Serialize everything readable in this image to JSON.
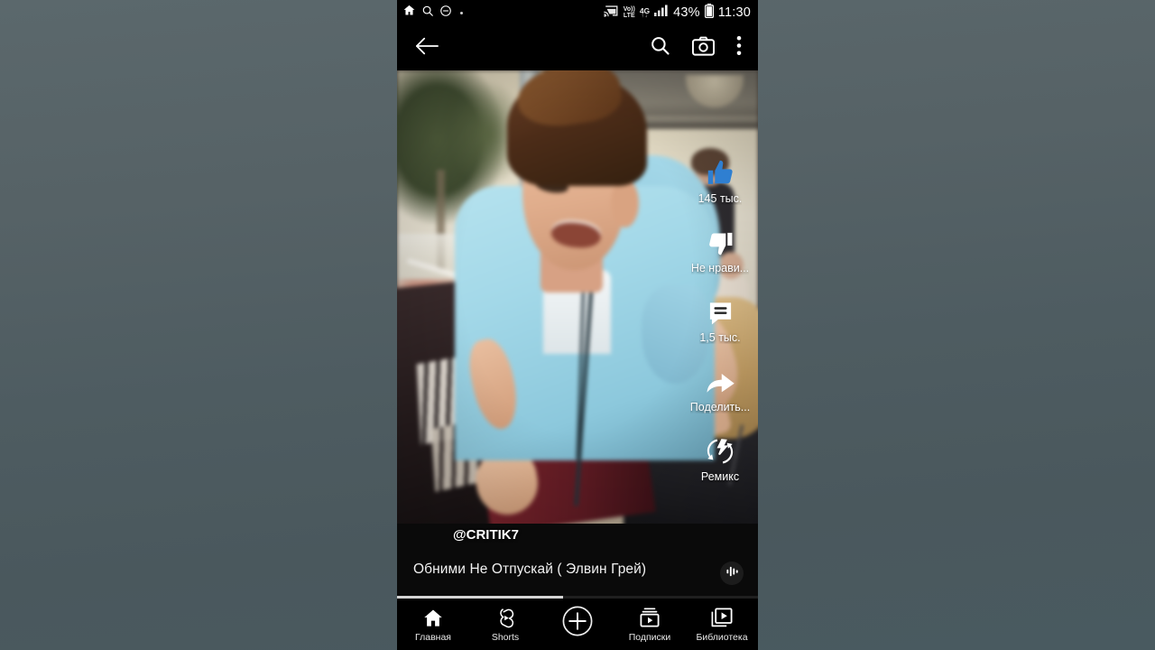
{
  "statusbar": {
    "icons": [
      "home-icon",
      "search-icon",
      "do-not-disturb-icon",
      "notification-dot"
    ],
    "cast_icon": "cast-icon",
    "volte": "Vo)) LTE",
    "volte_top": "Vo))",
    "volte_bottom": "LTE",
    "network": "4G",
    "network_sub": "↑↓",
    "signal_icon": "signal-bars-icon",
    "battery_percent": "43%",
    "battery_icon": "battery-icon",
    "time": "11:30"
  },
  "topbar": {
    "back_icon": "back-arrow-icon",
    "search_icon": "search-icon",
    "camera_icon": "camera-icon",
    "more_icon": "more-vertical-icon"
  },
  "actions": [
    {
      "name": "like",
      "icon": "thumbs-up-icon",
      "label": "145 тыс.",
      "active": true,
      "color": "#2f7fd1"
    },
    {
      "name": "dislike",
      "icon": "thumbs-down-icon",
      "label": "Не нрави...",
      "active": false,
      "color": "#ffffff"
    },
    {
      "name": "comments",
      "icon": "comment-icon",
      "label": "1,5 тыс.",
      "active": false,
      "color": "#ffffff"
    },
    {
      "name": "share",
      "icon": "share-arrow-icon",
      "label": "Поделить...",
      "active": false,
      "color": "#ffffff"
    },
    {
      "name": "remix",
      "icon": "remix-icon",
      "label": "Ремикс",
      "active": false,
      "color": "#ffffff"
    }
  ],
  "meta": {
    "handle": "@CRITIK7",
    "title": "Обними Не Отпускай ( Элвин Грей)",
    "audio_icon": "audio-wave-icon",
    "progress_percent": 46
  },
  "bottomnav": [
    {
      "name": "home",
      "icon": "home-icon",
      "label": "Главная"
    },
    {
      "name": "shorts",
      "icon": "shorts-icon",
      "label": "Shorts"
    },
    {
      "name": "create",
      "icon": "plus-circle-icon",
      "label": ""
    },
    {
      "name": "subscriptions",
      "icon": "subscriptions-icon",
      "label": "Подписки"
    },
    {
      "name": "library",
      "icon": "library-icon",
      "label": "Библиотека"
    }
  ],
  "colors": {
    "page_bg_top": "#5b686c",
    "page_bg_bottom": "#495a60",
    "chrome": "#000000",
    "like_blue": "#2f7fd1",
    "progress": "#d4d4d4"
  }
}
